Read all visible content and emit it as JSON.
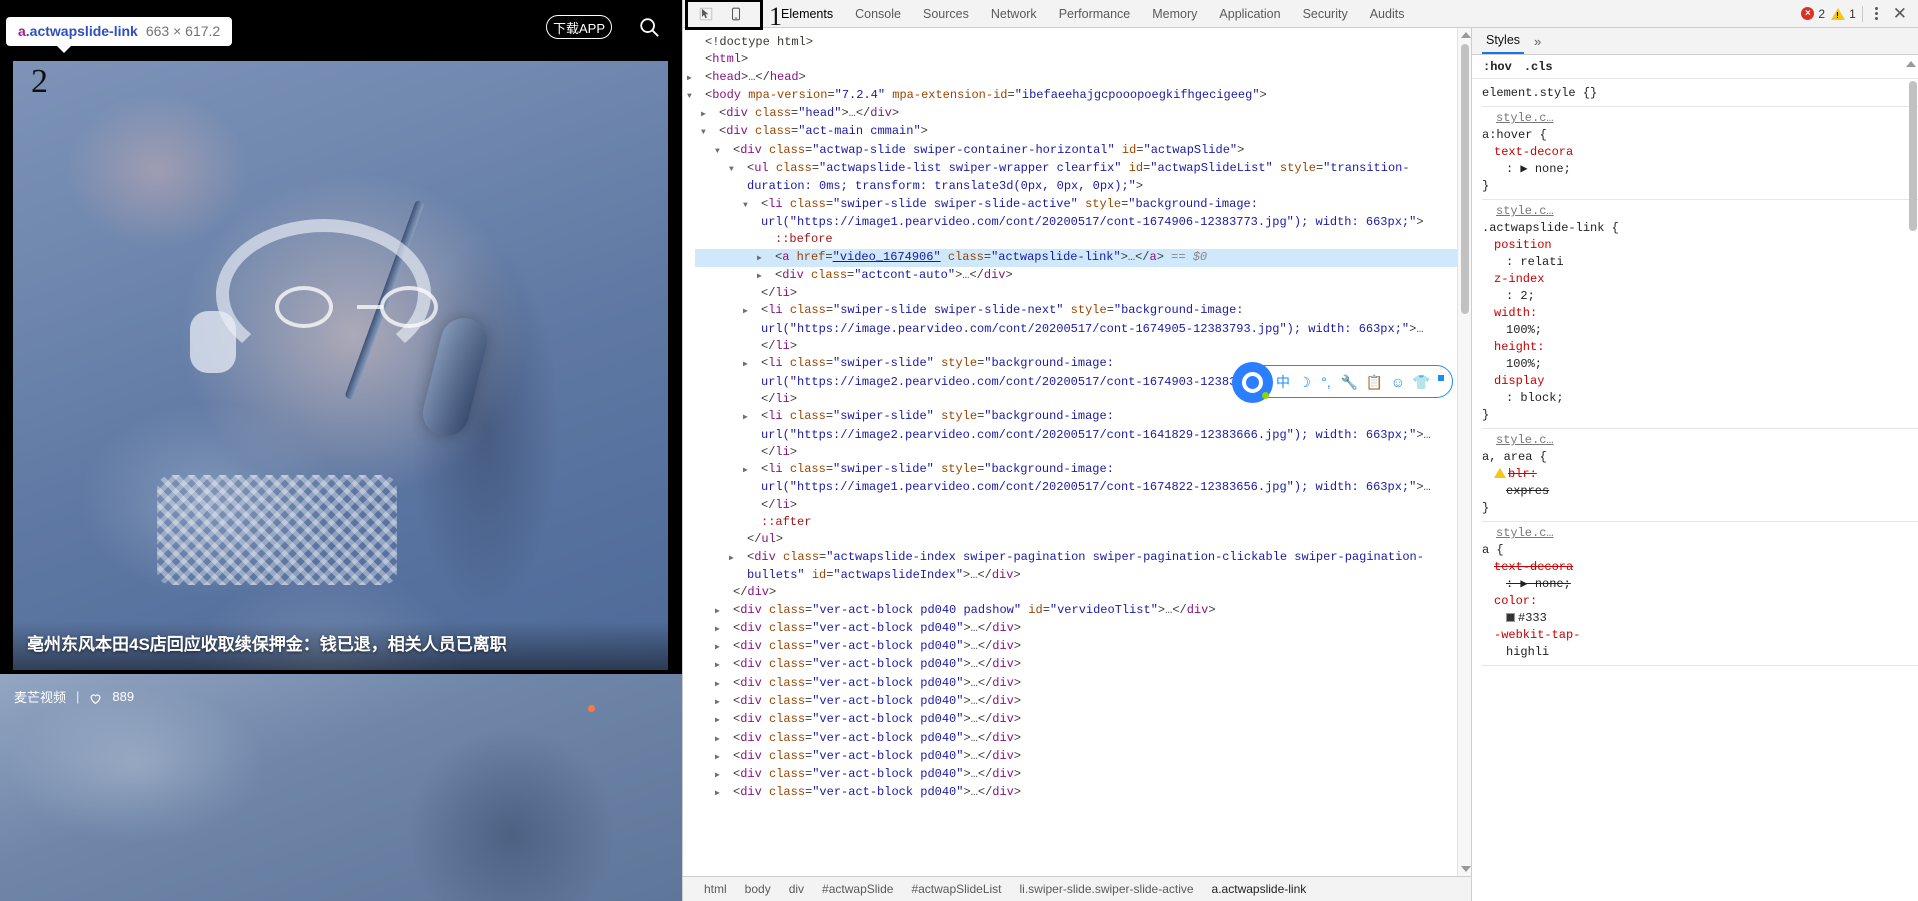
{
  "inspect_tooltip": {
    "tag": "a",
    "class": ".actwapslide-link",
    "dimensions": "663 × 617.2"
  },
  "annotations": {
    "marker_1": "1",
    "marker_2": "2"
  },
  "mobile_page": {
    "download_app_button": "下载APP",
    "search_icon": "search-icon",
    "video_title": "亳州东风本田4S店回应收取续保押金：钱已退，相关人员已离职",
    "channel": "麦芒视频",
    "separator": "|",
    "like_icon": "heart-icon",
    "like_count": "889"
  },
  "devtools": {
    "toolbar": {
      "inspect_icon": "cursor-inspect-icon",
      "device_toolbar_icon": "device-toggle-icon",
      "tabs": [
        "Elements",
        "Console",
        "Sources",
        "Network",
        "Performance",
        "Memory",
        "Application",
        "Security",
        "Audits"
      ],
      "active_tab": "Elements",
      "error_count": "2",
      "warning_count": "1",
      "more_icon": "kebab-menu-icon",
      "close_icon": "close-icon"
    },
    "dom_lines": [
      {
        "indent": 0,
        "tri": "",
        "html": "<span class=\"p\">&lt;!doctype html&gt;</span>"
      },
      {
        "indent": 0,
        "tri": "",
        "html": "<span class=\"p\">&lt;</span><span class=\"t\">html</span><span class=\"p\">&gt;</span>"
      },
      {
        "indent": 0,
        "tri": "▶",
        "html": "<span class=\"p\">&lt;</span><span class=\"t\">head</span><span class=\"p\">&gt;</span><span class=\"txt\">…</span><span class=\"p\">&lt;/</span><span class=\"t\">head</span><span class=\"p\">&gt;</span>"
      },
      {
        "indent": 0,
        "tri": "▼",
        "html": "<span class=\"p\">&lt;</span><span class=\"t\">body</span> <span class=\"a\">mpa-version</span><span class=\"p\">=</span><span class=\"v\">\"7.2.4\"</span> <span class=\"a\">mpa-extension-id</span><span class=\"p\">=</span><span class=\"v\">\"ibefaeehajgcpooopoegkifhgecigeeg\"</span><span class=\"p\">&gt;</span>"
      },
      {
        "indent": 1,
        "tri": "▶",
        "html": "<span class=\"p\">&lt;</span><span class=\"t\">div</span> <span class=\"a\">class</span><span class=\"p\">=</span><span class=\"v\">\"head\"</span><span class=\"p\">&gt;</span><span class=\"txt\">…</span><span class=\"p\">&lt;/</span><span class=\"t\">div</span><span class=\"p\">&gt;</span>"
      },
      {
        "indent": 1,
        "tri": "▼",
        "html": "<span class=\"p\">&lt;</span><span class=\"t\">div</span> <span class=\"a\">class</span><span class=\"p\">=</span><span class=\"v\">\"act-main cmmain\"</span><span class=\"p\">&gt;</span>"
      },
      {
        "indent": 2,
        "tri": "▼",
        "html": "<span class=\"p\">&lt;</span><span class=\"t\">div</span> <span class=\"a\">class</span><span class=\"p\">=</span><span class=\"v\">\"actwap-slide swiper-container-horizontal\"</span> <span class=\"a\">id</span><span class=\"p\">=</span><span class=\"v\">\"actwapSlide\"</span><span class=\"p\">&gt;</span>"
      },
      {
        "indent": 3,
        "tri": "▼",
        "html": "<span class=\"p\">&lt;</span><span class=\"t\">ul</span> <span class=\"a\">class</span><span class=\"p\">=</span><span class=\"v\">\"actwapslide-list swiper-wrapper clearfix\"</span> <span class=\"a\">id</span><span class=\"p\">=</span><span class=\"v\">\"actwapSlideList\"</span> <span class=\"a\">style</span><span class=\"p\">=</span><span class=\"v\">\"transition-duration: 0ms; transform: translate3d(0px, 0px, 0px);\"</span><span class=\"p\">&gt;</span>"
      },
      {
        "indent": 4,
        "tri": "▼",
        "html": "<span class=\"p\">&lt;</span><span class=\"t\">li</span> <span class=\"a\">class</span><span class=\"p\">=</span><span class=\"v\">\"swiper-slide swiper-slide-active\"</span> <span class=\"a\">style</span><span class=\"p\">=</span><span class=\"v\">\"background-image: url(\"https://image1.pearvideo.com/cont/20200517/cont-1674906-12383773.jpg\"); width: 663px;\"</span><span class=\"p\">&gt;</span>"
      },
      {
        "indent": 5,
        "tri": "",
        "html": "<span class=\"pseudo\">::before</span>"
      },
      {
        "indent": 5,
        "tri": "▶",
        "sel": true,
        "html": "<span class=\"p\">&lt;</span><span class=\"t\">a</span> <span class=\"a\">href</span><span class=\"p\">=</span><span class=\"lnk\">\"video_1674906\"</span> <span class=\"a\">class</span><span class=\"p\">=</span><span class=\"v\">\"actwapslide-link\"</span><span class=\"p\">&gt;</span><span class=\"txt\">…</span><span class=\"p\">&lt;/</span><span class=\"t\">a</span><span class=\"p\">&gt;</span> <span class=\"eq0\">== $0</span>"
      },
      {
        "indent": 5,
        "tri": "▶",
        "html": "<span class=\"p\">&lt;</span><span class=\"t\">div</span> <span class=\"a\">class</span><span class=\"p\">=</span><span class=\"v\">\"actcont-auto\"</span><span class=\"p\">&gt;</span><span class=\"txt\">…</span><span class=\"p\">&lt;/</span><span class=\"t\">div</span><span class=\"p\">&gt;</span>"
      },
      {
        "indent": 4,
        "tri": "",
        "html": "<span class=\"p\">&lt;/</span><span class=\"t\">li</span><span class=\"p\">&gt;</span>"
      },
      {
        "indent": 4,
        "tri": "▶",
        "html": "<span class=\"p\">&lt;</span><span class=\"t\">li</span> <span class=\"a\">class</span><span class=\"p\">=</span><span class=\"v\">\"swiper-slide swiper-slide-next\"</span> <span class=\"a\">style</span><span class=\"p\">=</span><span class=\"v\">\"background-image: url(\"https://image.pearvideo.com/cont/20200517/cont-1674905-12383793.jpg\"); width: 663px;\"</span><span class=\"p\">&gt;</span><span class=\"txt\">…</span><span class=\"p\">&lt;/</span><span class=\"t\">li</span><span class=\"p\">&gt;</span>"
      },
      {
        "indent": 4,
        "tri": "▶",
        "html": "<span class=\"p\">&lt;</span><span class=\"t\">li</span> <span class=\"a\">class</span><span class=\"p\">=</span><span class=\"v\">\"swiper-slide\"</span> <span class=\"a\">style</span><span class=\"p\">=</span><span class=\"v\">\"background-image: url(\"https://image2.pearvideo.com/cont/20200517/cont-1674903-12383708.jpg\"); width: 663px;\"</span><span class=\"p\">&gt;</span><span class=\"txt\">…</span><span class=\"p\">&lt;/</span><span class=\"t\">li</span><span class=\"p\">&gt;</span>"
      },
      {
        "indent": 4,
        "tri": "▶",
        "html": "<span class=\"p\">&lt;</span><span class=\"t\">li</span> <span class=\"a\">class</span><span class=\"p\">=</span><span class=\"v\">\"swiper-slide\"</span> <span class=\"a\">style</span><span class=\"p\">=</span><span class=\"v\">\"background-image: url(\"https://image2.pearvideo.com/cont/20200517/cont-1641829-12383666.jpg\"); width: 663px;\"</span><span class=\"p\">&gt;</span><span class=\"txt\">…</span><span class=\"p\">&lt;/</span><span class=\"t\">li</span><span class=\"p\">&gt;</span>"
      },
      {
        "indent": 4,
        "tri": "▶",
        "html": "<span class=\"p\">&lt;</span><span class=\"t\">li</span> <span class=\"a\">class</span><span class=\"p\">=</span><span class=\"v\">\"swiper-slide\"</span> <span class=\"a\">style</span><span class=\"p\">=</span><span class=\"v\">\"background-image: url(\"https://image1.pearvideo.com/cont/20200517/cont-1674822-12383656.jpg\"); width: 663px;\"</span><span class=\"p\">&gt;</span><span class=\"txt\">…</span><span class=\"p\">&lt;/</span><span class=\"t\">li</span><span class=\"p\">&gt;</span>"
      },
      {
        "indent": 4,
        "tri": "",
        "html": "<span class=\"pseudo\">::after</span>"
      },
      {
        "indent": 3,
        "tri": "",
        "html": "<span class=\"p\">&lt;/</span><span class=\"t\">ul</span><span class=\"p\">&gt;</span>"
      },
      {
        "indent": 3,
        "tri": "▶",
        "html": "<span class=\"p\">&lt;</span><span class=\"t\">div</span> <span class=\"a\">class</span><span class=\"p\">=</span><span class=\"v\">\"actwapslide-index swiper-pagination swiper-pagination-clickable swiper-pagination-bullets\"</span> <span class=\"a\">id</span><span class=\"p\">=</span><span class=\"v\">\"actwapslideIndex\"</span><span class=\"p\">&gt;</span><span class=\"txt\">…</span><span class=\"p\">&lt;/</span><span class=\"t\">div</span><span class=\"p\">&gt;</span>"
      },
      {
        "indent": 2,
        "tri": "",
        "html": "<span class=\"p\">&lt;/</span><span class=\"t\">div</span><span class=\"p\">&gt;</span>"
      },
      {
        "indent": 2,
        "tri": "▶",
        "html": "<span class=\"p\">&lt;</span><span class=\"t\">div</span> <span class=\"a\">class</span><span class=\"p\">=</span><span class=\"v\">\"ver-act-block pd040 padshow\"</span> <span class=\"a\">id</span><span class=\"p\">=</span><span class=\"v\">\"vervideoTlist\"</span><span class=\"p\">&gt;</span><span class=\"txt\">…</span><span class=\"p\">&lt;/</span><span class=\"t\">div</span><span class=\"p\">&gt;</span>"
      },
      {
        "indent": 2,
        "tri": "▶",
        "html": "<span class=\"p\">&lt;</span><span class=\"t\">div</span> <span class=\"a\">class</span><span class=\"p\">=</span><span class=\"v\">\"ver-act-block pd040\"</span><span class=\"p\">&gt;</span><span class=\"txt\">…</span><span class=\"p\">&lt;/</span><span class=\"t\">div</span><span class=\"p\">&gt;</span>"
      },
      {
        "indent": 2,
        "tri": "▶",
        "html": "<span class=\"p\">&lt;</span><span class=\"t\">div</span> <span class=\"a\">class</span><span class=\"p\">=</span><span class=\"v\">\"ver-act-block pd040\"</span><span class=\"p\">&gt;</span><span class=\"txt\">…</span><span class=\"p\">&lt;/</span><span class=\"t\">div</span><span class=\"p\">&gt;</span>"
      },
      {
        "indent": 2,
        "tri": "▶",
        "html": "<span class=\"p\">&lt;</span><span class=\"t\">div</span> <span class=\"a\">class</span><span class=\"p\">=</span><span class=\"v\">\"ver-act-block pd040\"</span><span class=\"p\">&gt;</span><span class=\"txt\">…</span><span class=\"p\">&lt;/</span><span class=\"t\">div</span><span class=\"p\">&gt;</span>"
      },
      {
        "indent": 2,
        "tri": "▶",
        "html": "<span class=\"p\">&lt;</span><span class=\"t\">div</span> <span class=\"a\">class</span><span class=\"p\">=</span><span class=\"v\">\"ver-act-block pd040\"</span><span class=\"p\">&gt;</span><span class=\"txt\">…</span><span class=\"p\">&lt;/</span><span class=\"t\">div</span><span class=\"p\">&gt;</span>"
      },
      {
        "indent": 2,
        "tri": "▶",
        "html": "<span class=\"p\">&lt;</span><span class=\"t\">div</span> <span class=\"a\">class</span><span class=\"p\">=</span><span class=\"v\">\"ver-act-block pd040\"</span><span class=\"p\">&gt;</span><span class=\"txt\">…</span><span class=\"p\">&lt;/</span><span class=\"t\">div</span><span class=\"p\">&gt;</span>"
      },
      {
        "indent": 2,
        "tri": "▶",
        "html": "<span class=\"p\">&lt;</span><span class=\"t\">div</span> <span class=\"a\">class</span><span class=\"p\">=</span><span class=\"v\">\"ver-act-block pd040\"</span><span class=\"p\">&gt;</span><span class=\"txt\">…</span><span class=\"p\">&lt;/</span><span class=\"t\">div</span><span class=\"p\">&gt;</span>"
      },
      {
        "indent": 2,
        "tri": "▶",
        "html": "<span class=\"p\">&lt;</span><span class=\"t\">div</span> <span class=\"a\">class</span><span class=\"p\">=</span><span class=\"v\">\"ver-act-block pd040\"</span><span class=\"p\">&gt;</span><span class=\"txt\">…</span><span class=\"p\">&lt;/</span><span class=\"t\">div</span><span class=\"p\">&gt;</span>"
      },
      {
        "indent": 2,
        "tri": "▶",
        "html": "<span class=\"p\">&lt;</span><span class=\"t\">div</span> <span class=\"a\">class</span><span class=\"p\">=</span><span class=\"v\">\"ver-act-block pd040\"</span><span class=\"p\">&gt;</span><span class=\"txt\">…</span><span class=\"p\">&lt;/</span><span class=\"t\">div</span><span class=\"p\">&gt;</span>"
      },
      {
        "indent": 2,
        "tri": "▶",
        "html": "<span class=\"p\">&lt;</span><span class=\"t\">div</span> <span class=\"a\">class</span><span class=\"p\">=</span><span class=\"v\">\"ver-act-block pd040\"</span><span class=\"p\">&gt;</span><span class=\"txt\">…</span><span class=\"p\">&lt;/</span><span class=\"t\">div</span><span class=\"p\">&gt;</span>"
      },
      {
        "indent": 2,
        "tri": "▶",
        "html": "<span class=\"p\">&lt;</span><span class=\"t\">div</span> <span class=\"a\">class</span><span class=\"p\">=</span><span class=\"v\">\"ver-act-block pd040\"</span><span class=\"p\">&gt;</span><span class=\"txt\">…</span><span class=\"p\">&lt;/</span><span class=\"t\">div</span><span class=\"p\">&gt;</span>"
      }
    ],
    "breadcrumbs": [
      "html",
      "body",
      "div",
      "#actwapSlide",
      "#actwapSlideList",
      "li.swiper-slide.swiper-slide-active",
      "a.actwapslide-link"
    ],
    "styles": {
      "tab_label": "Styles",
      "more_icon": "chevron-double-right-icon",
      "filters": [
        ":hov",
        ".cls"
      ],
      "rules": [
        {
          "source": "",
          "selector": "element.style {",
          "declarations": [],
          "close": "}"
        },
        {
          "source": "style.c…",
          "selector": "a:hover {",
          "declarations": [
            {
              "prop": "text-decora",
              "value": ": ▶ none;"
            }
          ],
          "close": "}"
        },
        {
          "source": "style.c…",
          "selector": ".actwapslide-link {",
          "declarations": [
            {
              "prop": "position",
              "value": ": relati"
            },
            {
              "prop": "z-index",
              "value": ": 2;"
            },
            {
              "prop": "width:",
              "value": "100%;"
            },
            {
              "prop": "height:",
              "value": "100%;"
            },
            {
              "prop": "display",
              "value": ": block;"
            }
          ],
          "close": "}"
        },
        {
          "source": "style.c…",
          "selector": "a, area {",
          "declarations": [
            {
              "prop": "blr:",
              "value": "expres",
              "warn": true,
              "strike": true
            }
          ],
          "close": "}"
        },
        {
          "source": "style.c…",
          "selector": "a {",
          "declarations": [
            {
              "prop": "text-decora",
              "value": ": ▶ none;",
              "strike": true
            },
            {
              "prop": "color:",
              "value": "#333",
              "swatch": true
            },
            {
              "prop": "-webkit-tap-",
              "value": "highli"
            }
          ],
          "close": ""
        }
      ]
    },
    "float_toolbar": {
      "logo": "qq-browser-logo-icon",
      "icons": [
        "中",
        "moon-icon",
        "comma-icon",
        "wrench-icon",
        "clipboard-icon",
        "smiley-icon",
        "tshirt-icon",
        "grid-icon"
      ]
    }
  }
}
